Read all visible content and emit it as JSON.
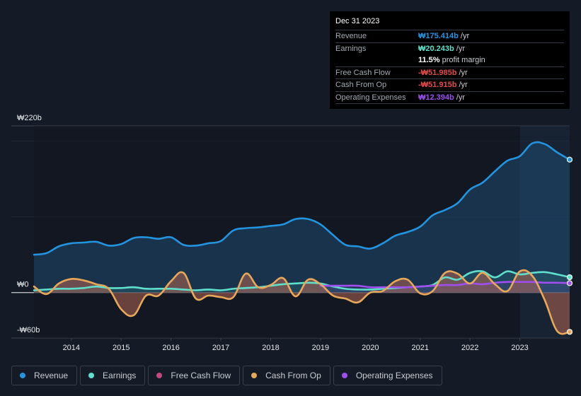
{
  "tooltip": {
    "date": "Dec 31 2023",
    "rows": [
      {
        "label": "Revenue",
        "value": "₩175.414b",
        "unit": " /yr",
        "color": "#2394df"
      },
      {
        "label": "Earnings",
        "value": "₩20.243b",
        "unit": " /yr",
        "color": "#5ee0cc"
      },
      {
        "label": "",
        "value": "11.5%",
        "unit": " profit margin",
        "color": "#ffffff"
      },
      {
        "label": "Free Cash Flow",
        "value": "-₩51.985b",
        "unit": " /yr",
        "color": "#e64a4a"
      },
      {
        "label": "Cash From Op",
        "value": "-₩51.915b",
        "unit": " /yr",
        "color": "#e64a4a"
      },
      {
        "label": "Operating Expenses",
        "value": "₩12.394b",
        "unit": " /yr",
        "color": "#a04ef0"
      }
    ]
  },
  "legend": [
    {
      "label": "Revenue",
      "color": "#2394df"
    },
    {
      "label": "Earnings",
      "color": "#5ee0cc"
    },
    {
      "label": "Free Cash Flow",
      "color": "#c2497f"
    },
    {
      "label": "Cash From Op",
      "color": "#e8a85a"
    },
    {
      "label": "Operating Expenses",
      "color": "#a04ef0"
    }
  ],
  "chart_data": {
    "type": "line",
    "title": "",
    "xlabel": "",
    "ylabel": "",
    "ylim": [
      -60,
      220
    ],
    "xlim": [
      2013.25,
      2024.0
    ],
    "y_tick_labels": [
      {
        "value": 220,
        "label": "₩220b"
      },
      {
        "value": 0,
        "label": "₩0"
      },
      {
        "value": -60,
        "label": "-₩60b"
      }
    ],
    "x_tick_labels": [
      "2014",
      "2015",
      "2016",
      "2017",
      "2018",
      "2019",
      "2020",
      "2021",
      "2022",
      "2023"
    ],
    "x_ticks": [
      2014,
      2015,
      2016,
      2017,
      2018,
      2019,
      2020,
      2021,
      2022,
      2023
    ],
    "highlight_from": 2023.0,
    "legend_position": "bottom",
    "grid": true,
    "series": [
      {
        "name": "Revenue",
        "color": "#2394df",
        "x": [
          2013.25,
          2013.5,
          2013.75,
          2014.0,
          2014.25,
          2014.5,
          2014.75,
          2015.0,
          2015.25,
          2015.5,
          2015.75,
          2016.0,
          2016.25,
          2016.5,
          2016.75,
          2017.0,
          2017.25,
          2017.5,
          2017.75,
          2018.0,
          2018.25,
          2018.5,
          2018.75,
          2019.0,
          2019.25,
          2019.5,
          2019.75,
          2020.0,
          2020.25,
          2020.5,
          2020.75,
          2021.0,
          2021.25,
          2021.5,
          2021.75,
          2022.0,
          2022.25,
          2022.5,
          2022.75,
          2023.0,
          2023.25,
          2023.5,
          2023.75,
          2024.0
        ],
        "values": [
          50,
          52,
          61,
          65,
          66,
          67,
          62,
          64,
          72,
          73,
          71,
          73,
          63,
          62,
          65,
          68,
          82,
          85,
          86,
          88,
          90,
          97,
          97,
          90,
          76,
          63,
          61,
          58,
          65,
          75,
          80,
          87,
          102,
          109,
          118,
          136,
          145,
          160,
          174,
          180,
          197,
          196,
          185,
          175.4
        ]
      },
      {
        "name": "Earnings",
        "color": "#5ee0cc",
        "x": [
          2013.25,
          2013.5,
          2013.75,
          2014.0,
          2014.25,
          2014.5,
          2014.75,
          2015.0,
          2015.25,
          2015.5,
          2015.75,
          2016.0,
          2016.25,
          2016.5,
          2016.75,
          2017.0,
          2017.25,
          2017.5,
          2017.75,
          2018.0,
          2018.25,
          2018.5,
          2018.75,
          2019.0,
          2019.25,
          2019.5,
          2019.75,
          2020.0,
          2020.25,
          2020.5,
          2020.75,
          2021.0,
          2021.25,
          2021.5,
          2021.75,
          2022.0,
          2022.25,
          2022.5,
          2022.75,
          2023.0,
          2023.25,
          2023.5,
          2023.75,
          2024.0
        ],
        "values": [
          3,
          4,
          5,
          5,
          6,
          8,
          6,
          6,
          7,
          5,
          5,
          5,
          4,
          3,
          4,
          3,
          5,
          6,
          7,
          9,
          11,
          12,
          13,
          12,
          8,
          5,
          4,
          4,
          5,
          6,
          7,
          8,
          10,
          20,
          17,
          26,
          28,
          20,
          28,
          24,
          26,
          27,
          24,
          20.2
        ]
      },
      {
        "name": "Free Cash Flow",
        "color": "#c2497f",
        "x": [
          2013.25,
          2013.5,
          2013.75,
          2014.0,
          2014.25,
          2014.5,
          2014.75,
          2015.0,
          2015.25,
          2015.5,
          2015.75,
          2016.0,
          2016.25,
          2016.5,
          2016.75,
          2017.0,
          2017.25,
          2017.5,
          2017.75,
          2018.0,
          2018.25,
          2018.5,
          2018.75,
          2019.0,
          2019.25,
          2019.5,
          2019.75,
          2020.0,
          2020.25,
          2020.5,
          2020.75,
          2021.0,
          2021.25,
          2021.5,
          2021.75,
          2022.0,
          2022.25,
          2022.5,
          2022.75,
          2023.0,
          2023.25,
          2023.5,
          2023.75,
          2024.0
        ],
        "values": [
          8,
          -2,
          12,
          18,
          16,
          11,
          5,
          -22,
          -30,
          -4,
          -4,
          15,
          26,
          -8,
          -4,
          -6,
          -6,
          25,
          7,
          10,
          19,
          -5,
          17,
          11,
          -4,
          -8,
          -13,
          0,
          2,
          15,
          17,
          -1,
          2,
          26,
          25,
          12,
          26,
          11,
          2,
          28,
          22,
          -10,
          -51,
          -52.0
        ]
      },
      {
        "name": "Cash From Op",
        "color": "#e8a85a",
        "x": [
          2013.25,
          2013.5,
          2013.75,
          2014.0,
          2014.25,
          2014.5,
          2014.75,
          2015.0,
          2015.25,
          2015.5,
          2015.75,
          2016.0,
          2016.25,
          2016.5,
          2016.75,
          2017.0,
          2017.25,
          2017.5,
          2017.75,
          2018.0,
          2018.25,
          2018.5,
          2018.75,
          2019.0,
          2019.25,
          2019.5,
          2019.75,
          2020.0,
          2020.25,
          2020.5,
          2020.75,
          2021.0,
          2021.25,
          2021.5,
          2021.75,
          2022.0,
          2022.25,
          2022.5,
          2022.75,
          2023.0,
          2023.25,
          2023.5,
          2023.75,
          2024.0
        ],
        "values": [
          8,
          -2,
          12,
          18,
          16,
          11,
          5,
          -22,
          -30,
          -4,
          -4,
          15,
          26,
          -8,
          -4,
          -6,
          -6,
          25,
          7,
          10,
          19,
          -5,
          17,
          11,
          -4,
          -8,
          -13,
          0,
          2,
          15,
          17,
          -1,
          2,
          26,
          25,
          12,
          26,
          11,
          2,
          28,
          22,
          -10,
          -51,
          -51.9
        ]
      },
      {
        "name": "Operating Expenses",
        "color": "#a04ef0",
        "x": [
          2019.0,
          2019.25,
          2019.5,
          2019.75,
          2020.0,
          2020.25,
          2020.5,
          2020.75,
          2021.0,
          2021.25,
          2021.5,
          2021.75,
          2022.0,
          2022.25,
          2022.5,
          2022.75,
          2023.0,
          2023.25,
          2023.5,
          2023.75,
          2024.0
        ],
        "values": [
          9,
          9,
          9,
          9,
          7,
          7,
          7,
          7,
          8,
          9,
          10,
          10,
          12,
          11,
          13,
          14,
          14,
          14,
          13,
          13,
          12.4
        ]
      }
    ]
  }
}
